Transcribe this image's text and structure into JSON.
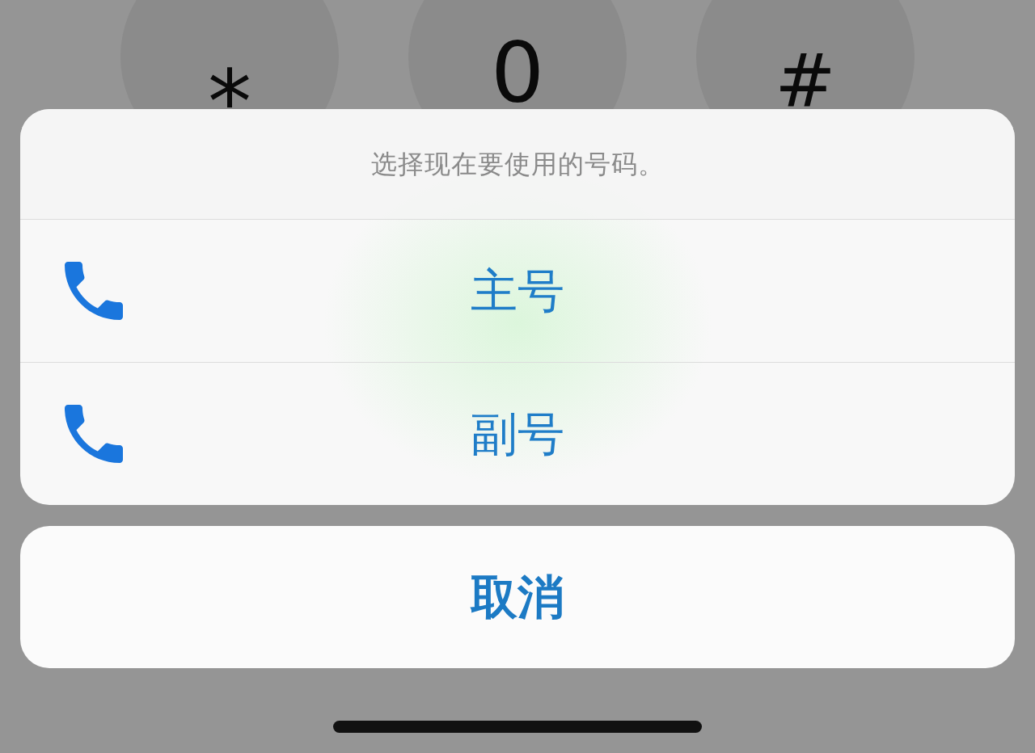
{
  "keypad_keys": [
    {
      "label": "*",
      "kind": "asterisk"
    },
    {
      "label": "0",
      "kind": "digit"
    },
    {
      "label": "#",
      "kind": "hash"
    }
  ],
  "action_sheet": {
    "title": "选择现在要使用的号码。",
    "options": [
      {
        "label": "主号"
      },
      {
        "label": "副号"
      }
    ]
  },
  "cancel_button": {
    "label": "取消"
  }
}
